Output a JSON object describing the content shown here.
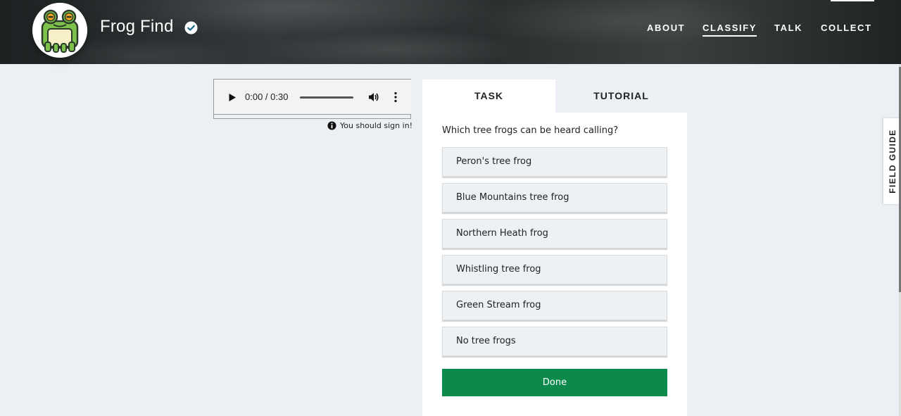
{
  "header": {
    "project_title": "Frog Find",
    "avatar_icon": "frog-logo-icon",
    "verified_icon": "verified-check-icon",
    "nav": [
      {
        "label": "ABOUT",
        "active": false
      },
      {
        "label": "CLASSIFY",
        "active": true
      },
      {
        "label": "TALK",
        "active": false
      },
      {
        "label": "COLLECT",
        "active": false
      }
    ]
  },
  "audio": {
    "time": "0:00 / 0:30",
    "progress": 0,
    "icons": [
      "play-icon",
      "volume-icon",
      "more-vert-icon"
    ]
  },
  "signin_note": "You should sign in!",
  "task": {
    "tabs": [
      "TASK",
      "TUTORIAL"
    ],
    "active_tab": "TASK",
    "question": "Which tree frogs can be heard calling?",
    "answers": [
      "Peron's tree frog",
      "Blue Mountains tree frog",
      "Northern Heath frog",
      "Whistling tree frog",
      "Green Stream frog",
      "No tree frogs"
    ],
    "done_label": "Done"
  },
  "field_guide": "FIELD GUIDE",
  "colors": {
    "done_button": "#0b8a4c",
    "page_background": "#eceff4",
    "verified": "#1f6f8b"
  }
}
